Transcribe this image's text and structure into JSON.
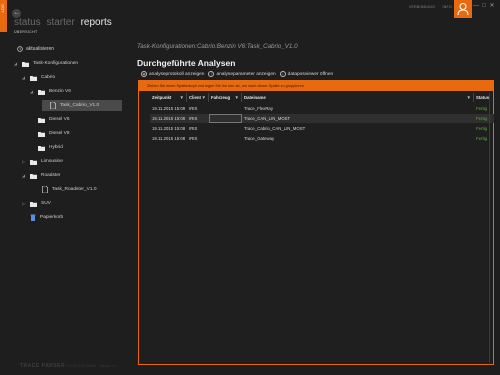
{
  "app": {
    "side_badge": "LOG",
    "top_right": [
      "VERBINDUNG",
      "INFO"
    ],
    "window_controls": [
      "—",
      "□",
      "✕"
    ],
    "user_icon": "user-icon",
    "accent_color": "#e86a10"
  },
  "nav": {
    "tabs": [
      "status",
      "starter",
      "reports"
    ],
    "active_tab": "reports",
    "subnav": "ÜBERSICHT"
  },
  "sidebar": {
    "refresh_label": "aktualisieren",
    "tree": [
      {
        "label": "Task-Konfigurationen",
        "icon": "folder-icon",
        "expander": "◢"
      },
      {
        "label": "Cabrio",
        "icon": "folder-icon",
        "expander": "◢"
      },
      {
        "label": "Benzin V6",
        "icon": "folder-icon",
        "expander": "◢"
      },
      {
        "label": "Task_Cabrio_V1.0",
        "icon": "document-icon",
        "expander": ""
      },
      {
        "label": "Diesel V6",
        "icon": "folder-icon",
        "expander": ""
      },
      {
        "label": "Diesel V8",
        "icon": "folder-icon",
        "expander": ""
      },
      {
        "label": "Hybrid",
        "icon": "folder-icon",
        "expander": ""
      },
      {
        "label": "Limousine",
        "icon": "folder-icon",
        "expander": "▷"
      },
      {
        "label": "Roadster",
        "icon": "folder-icon",
        "expander": "◢"
      },
      {
        "label": "Task_Roadster_V1.0",
        "icon": "document-icon",
        "expander": ""
      },
      {
        "label": "SUV",
        "icon": "folder-icon",
        "expander": "▷"
      },
      {
        "label": "Papierkorb",
        "icon": "trash-icon",
        "expander": ""
      }
    ]
  },
  "main": {
    "breadcrumb": "Task-Konfigurationen:Cabrio:Benzin V6:Task_Cabrio_V1.0",
    "title": "Durchgeführte Analysen",
    "toolbar": [
      {
        "label": "analyseprotokoll anzeigen",
        "icon": "eye-icon"
      },
      {
        "label": "analyseparameter anzeigen",
        "icon": "info-icon"
      },
      {
        "label": "dataposviewer öffnen",
        "icon": "search-icon"
      }
    ]
  },
  "grid": {
    "group_hint": "Ziehen Sie einen Spaltenkopf und legen Sie ihn hier ab, um nach dieser Spalte zu gruppieren",
    "columns": [
      "Zeitpunkt",
      "Client",
      "Fahrzeug",
      "Dateiname",
      "Status"
    ],
    "rows": [
      {
        "zeitpunkt": "19.11.2015 15:09",
        "client": "IRIS",
        "fahrzeug": "",
        "dateiname": "Trace_FlexRay",
        "status": "Fertig"
      },
      {
        "zeitpunkt": "19.11.2015 15:08",
        "client": "IRIS",
        "fahrzeug": "",
        "dateiname": "Trace_CAN_LIN_MOST",
        "status": "Fertig"
      },
      {
        "zeitpunkt": "19.11.2015 15:08",
        "client": "IRIS",
        "fahrzeug": "",
        "dateiname": "Trace_Cabrio_CAN_LIN_MOST",
        "status": "Fertig"
      },
      {
        "zeitpunkt": "19.11.2015 15:08",
        "client": "IRIS",
        "fahrzeug": "",
        "dateiname": "Trace_Gateway",
        "status": "Fertig"
      }
    ]
  },
  "footer": {
    "logo": "TRACE PARSER",
    "copyright": "© 2015 IRIS GmbH  -  Version 3.x"
  }
}
